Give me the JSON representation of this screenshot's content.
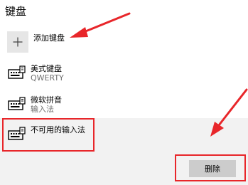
{
  "section": {
    "title": "键盘"
  },
  "add_keyboard": {
    "label": "添加键盘",
    "icon": "plus-icon"
  },
  "keyboards": [
    {
      "name": "美式键盘",
      "layout": "QWERTY",
      "icon": "keyboard-icon"
    },
    {
      "name": "微软拼音",
      "layout": "输入法",
      "icon": "keyboard-icon"
    },
    {
      "name": "不可用的输入法",
      "layout": "",
      "icon": "keyboard-icon"
    }
  ],
  "actions": {
    "delete_label": "删除"
  },
  "colors": {
    "annotation_red": "#e8262a",
    "selected_background": "#f2f2f2",
    "button_background": "#cccccc",
    "add_tile_background": "#e6e6e6"
  }
}
